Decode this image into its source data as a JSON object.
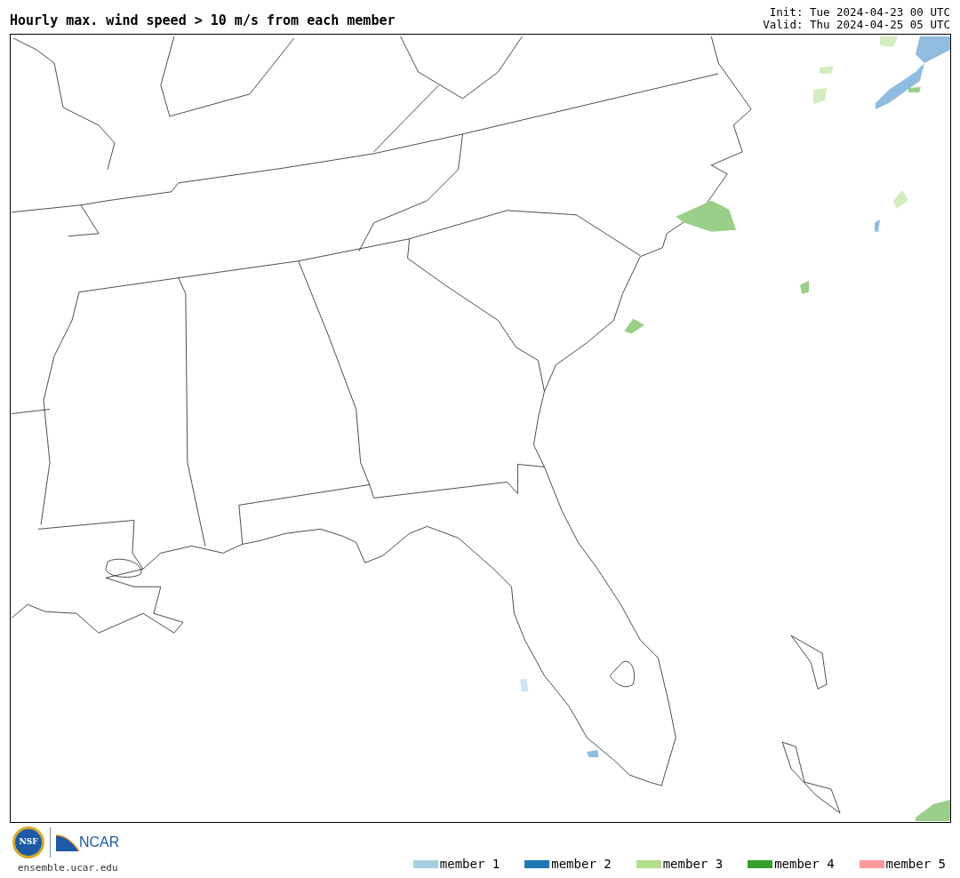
{
  "title": "Hourly max. wind speed > 10 m/s from each member",
  "init": "Init: Tue 2024-04-23 00 UTC",
  "valid": "Valid: Thu 2024-04-25 05 UTC",
  "logos": {
    "nsf": "NSF",
    "ncar": "NCAR"
  },
  "site": "ensemble.ucar.edu",
  "legend": [
    {
      "label": "member 1",
      "color": "#a6cee3"
    },
    {
      "label": "member 2",
      "color": "#1f78b4"
    },
    {
      "label": "member 3",
      "color": "#b2df8a"
    },
    {
      "label": "member 4",
      "color": "#33a02c"
    },
    {
      "label": "member 5",
      "color": "#fb9a99"
    }
  ]
}
